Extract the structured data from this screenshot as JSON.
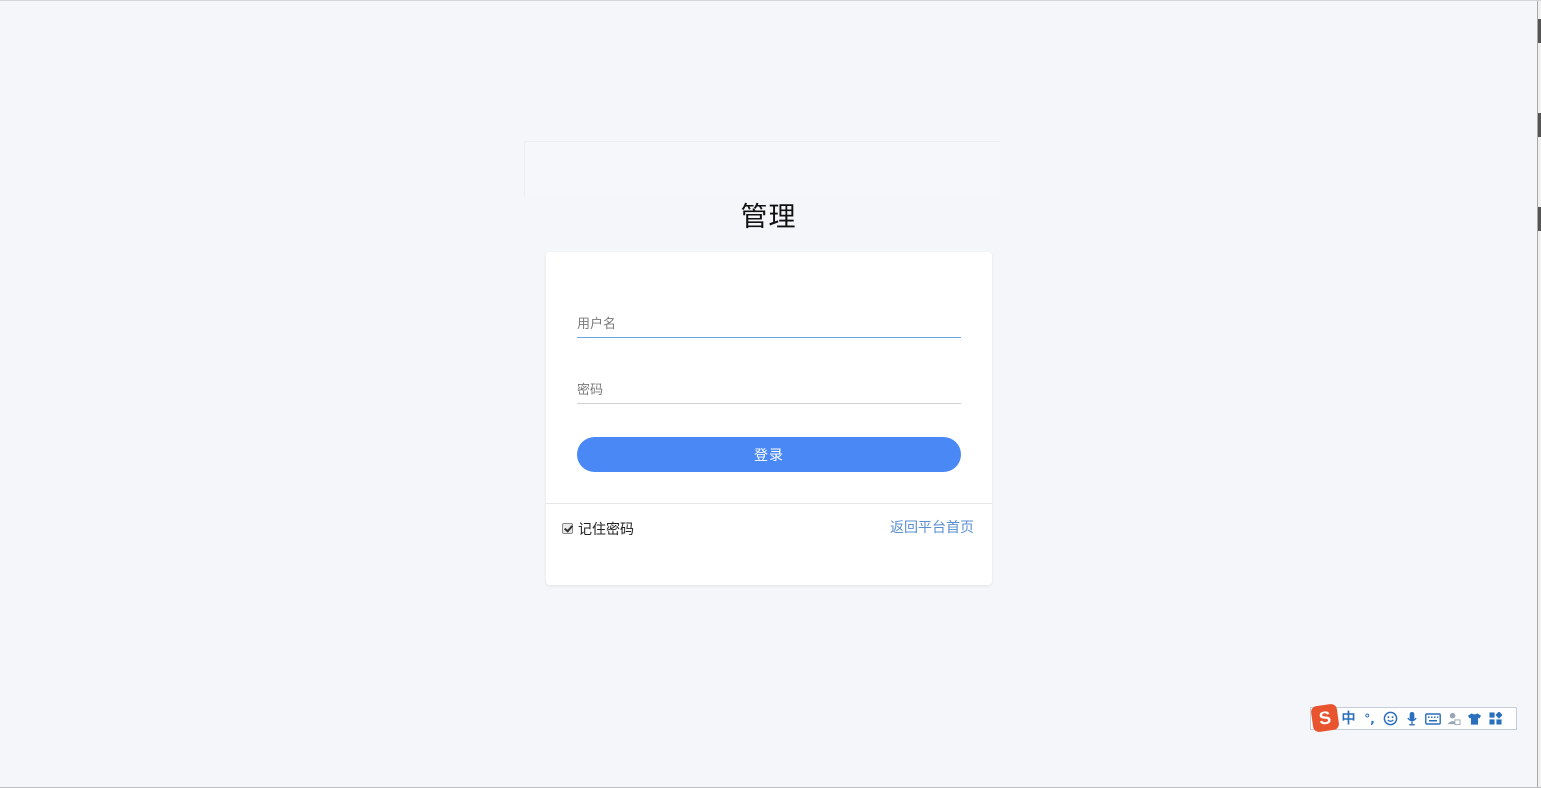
{
  "page": {
    "title": "管理"
  },
  "login_form": {
    "username_placeholder": "用户名",
    "password_placeholder": "密码",
    "submit_label": "登录",
    "remember_label": "记住密码",
    "remember_checked": true,
    "back_link_label": "返回平台首页"
  },
  "ime_toolbar": {
    "logo_letter": "S",
    "mode_label": "中",
    "punct_label": "°,",
    "icons": [
      "smiley-icon",
      "microphone-icon",
      "keyboard-icon",
      "user-icon",
      "shirt-icon",
      "grid-icon"
    ]
  },
  "colors": {
    "accent": "#4a89f5",
    "link": "#5a8fd0",
    "background": "#f5f6f9",
    "ime_brand": "#e8542d"
  }
}
